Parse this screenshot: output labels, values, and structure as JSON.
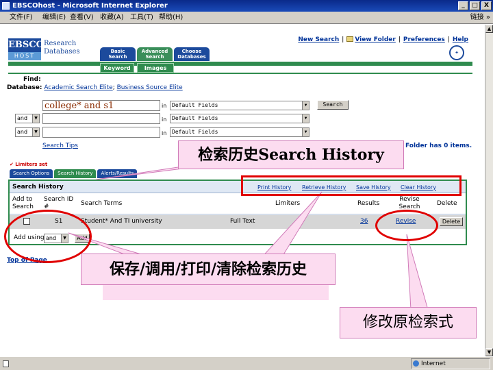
{
  "window": {
    "title": "EBSCOhost - Microsoft Internet Explorer",
    "controls": [
      "_",
      "□",
      "X"
    ]
  },
  "menubar": {
    "items": [
      "文件(F)",
      "编辑(E)",
      "查看(V)",
      "收藏(A)",
      "工具(T)",
      "帮助(H)"
    ],
    "links_label": "链接 »"
  },
  "toplinks": {
    "new_search": "New Search",
    "view_folder": "View Folder",
    "preferences": "Preferences",
    "help": "Help"
  },
  "logo": {
    "ebsco": "EBSCO",
    "host": "HOST",
    "line1": "Research",
    "line2": "Databases"
  },
  "nav_tabs": [
    {
      "line1": "Basic",
      "line2": "Search"
    },
    {
      "line1": "Advanced",
      "line2": "Search"
    },
    {
      "line1": "Choose",
      "line2": "Databases"
    }
  ],
  "sub_tabs": {
    "keyword": "Keyword",
    "images": "Images"
  },
  "database": {
    "label": "Database:",
    "db1": "Academic Search Elite",
    "separator": ";",
    "db2": "Business Source Elite"
  },
  "search_form": {
    "find_label": "Find:",
    "query": "college* and s1",
    "in_label": "in",
    "field_value": "Default Fields",
    "bool_value": "and",
    "search_button": "Search",
    "search_tips": "Search Tips",
    "folder_note": "Folder has 0 items."
  },
  "panel": {
    "limiters_set": "✔ Limiters set",
    "tabs": [
      "Search Options",
      "Search History",
      "Alerts/Results"
    ],
    "title": "Search History",
    "links": {
      "print": "Print History",
      "retrieve": "Retrieve History",
      "save": "Save History",
      "clear": "Clear History"
    },
    "columns": {
      "add": "Add to Search",
      "id": "Search ID #",
      "terms": "Search Terms",
      "limiters": "Limiters",
      "results": "Results",
      "revise": "Revise Search",
      "delete": "Delete"
    },
    "row": {
      "id": "S1",
      "terms": "Student* And TI university",
      "limiters": "Full Text",
      "results": "36",
      "revise": "Revise",
      "delete": "Delete"
    },
    "add_using_label": "Add using",
    "add_using_value": "and",
    "add_button": "Add"
  },
  "top_of_page": "Top of Page",
  "status": {
    "zone": "Internet"
  },
  "annotations": {
    "history": "检索历史Search History",
    "save": "保存/调用/打印/清除检索历史",
    "revise": "修改原检索式"
  },
  "colors": {
    "ebsco_blue": "#1c4a9c",
    "ebsco_green": "#2f8b4e",
    "callout_pink": "#fcdcf0",
    "highlight_red": "#e00000"
  }
}
